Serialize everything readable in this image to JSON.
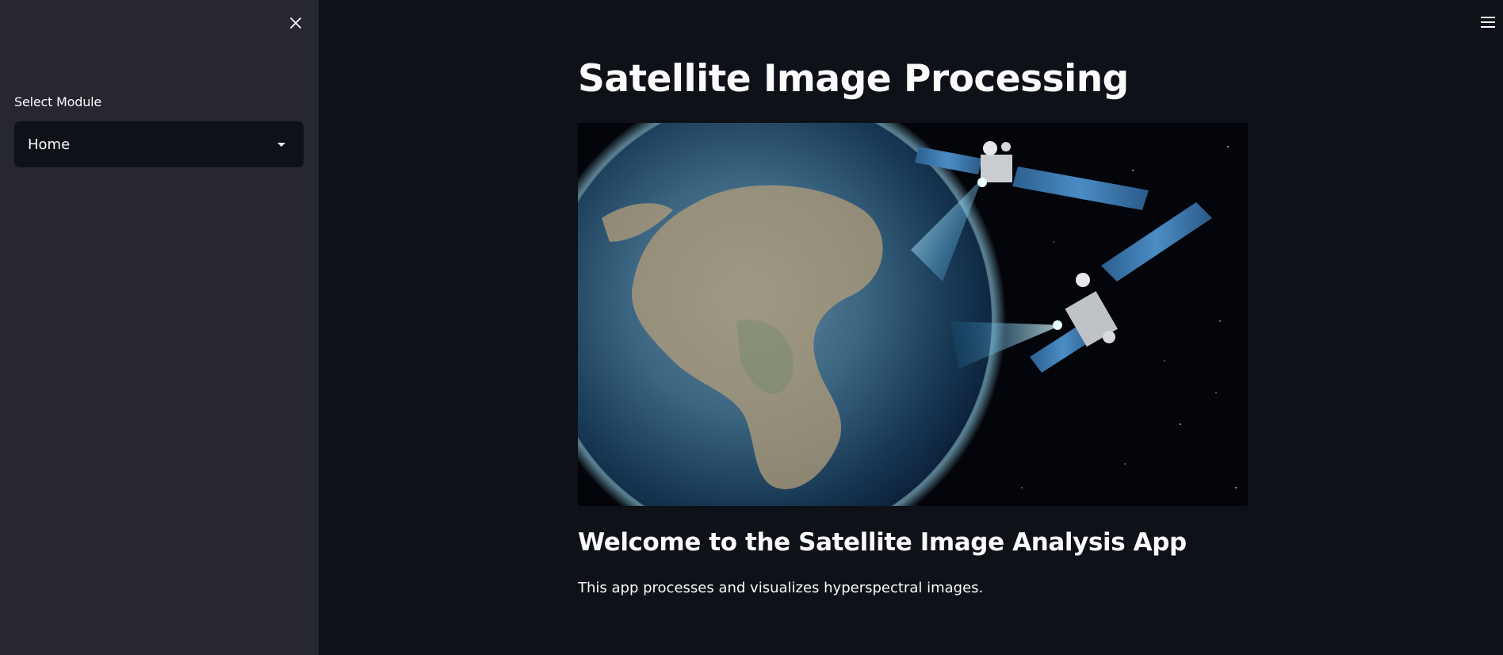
{
  "sidebar": {
    "close_icon": "close-icon",
    "select_label": "Select Module",
    "select_value": "Home",
    "caret_icon": "caret-down-icon"
  },
  "header": {
    "menu_icon": "hamburger-menu-icon"
  },
  "main": {
    "title": "Satellite Image Processing",
    "image_subject": "earth-with-satellites-image",
    "subheading": "Welcome to the Satellite Image Analysis App",
    "description": "This app processes and visualizes hyperspectral images."
  },
  "colors": {
    "background": "#0e1117",
    "sidebar": "#262730",
    "text": "#fafafa"
  }
}
